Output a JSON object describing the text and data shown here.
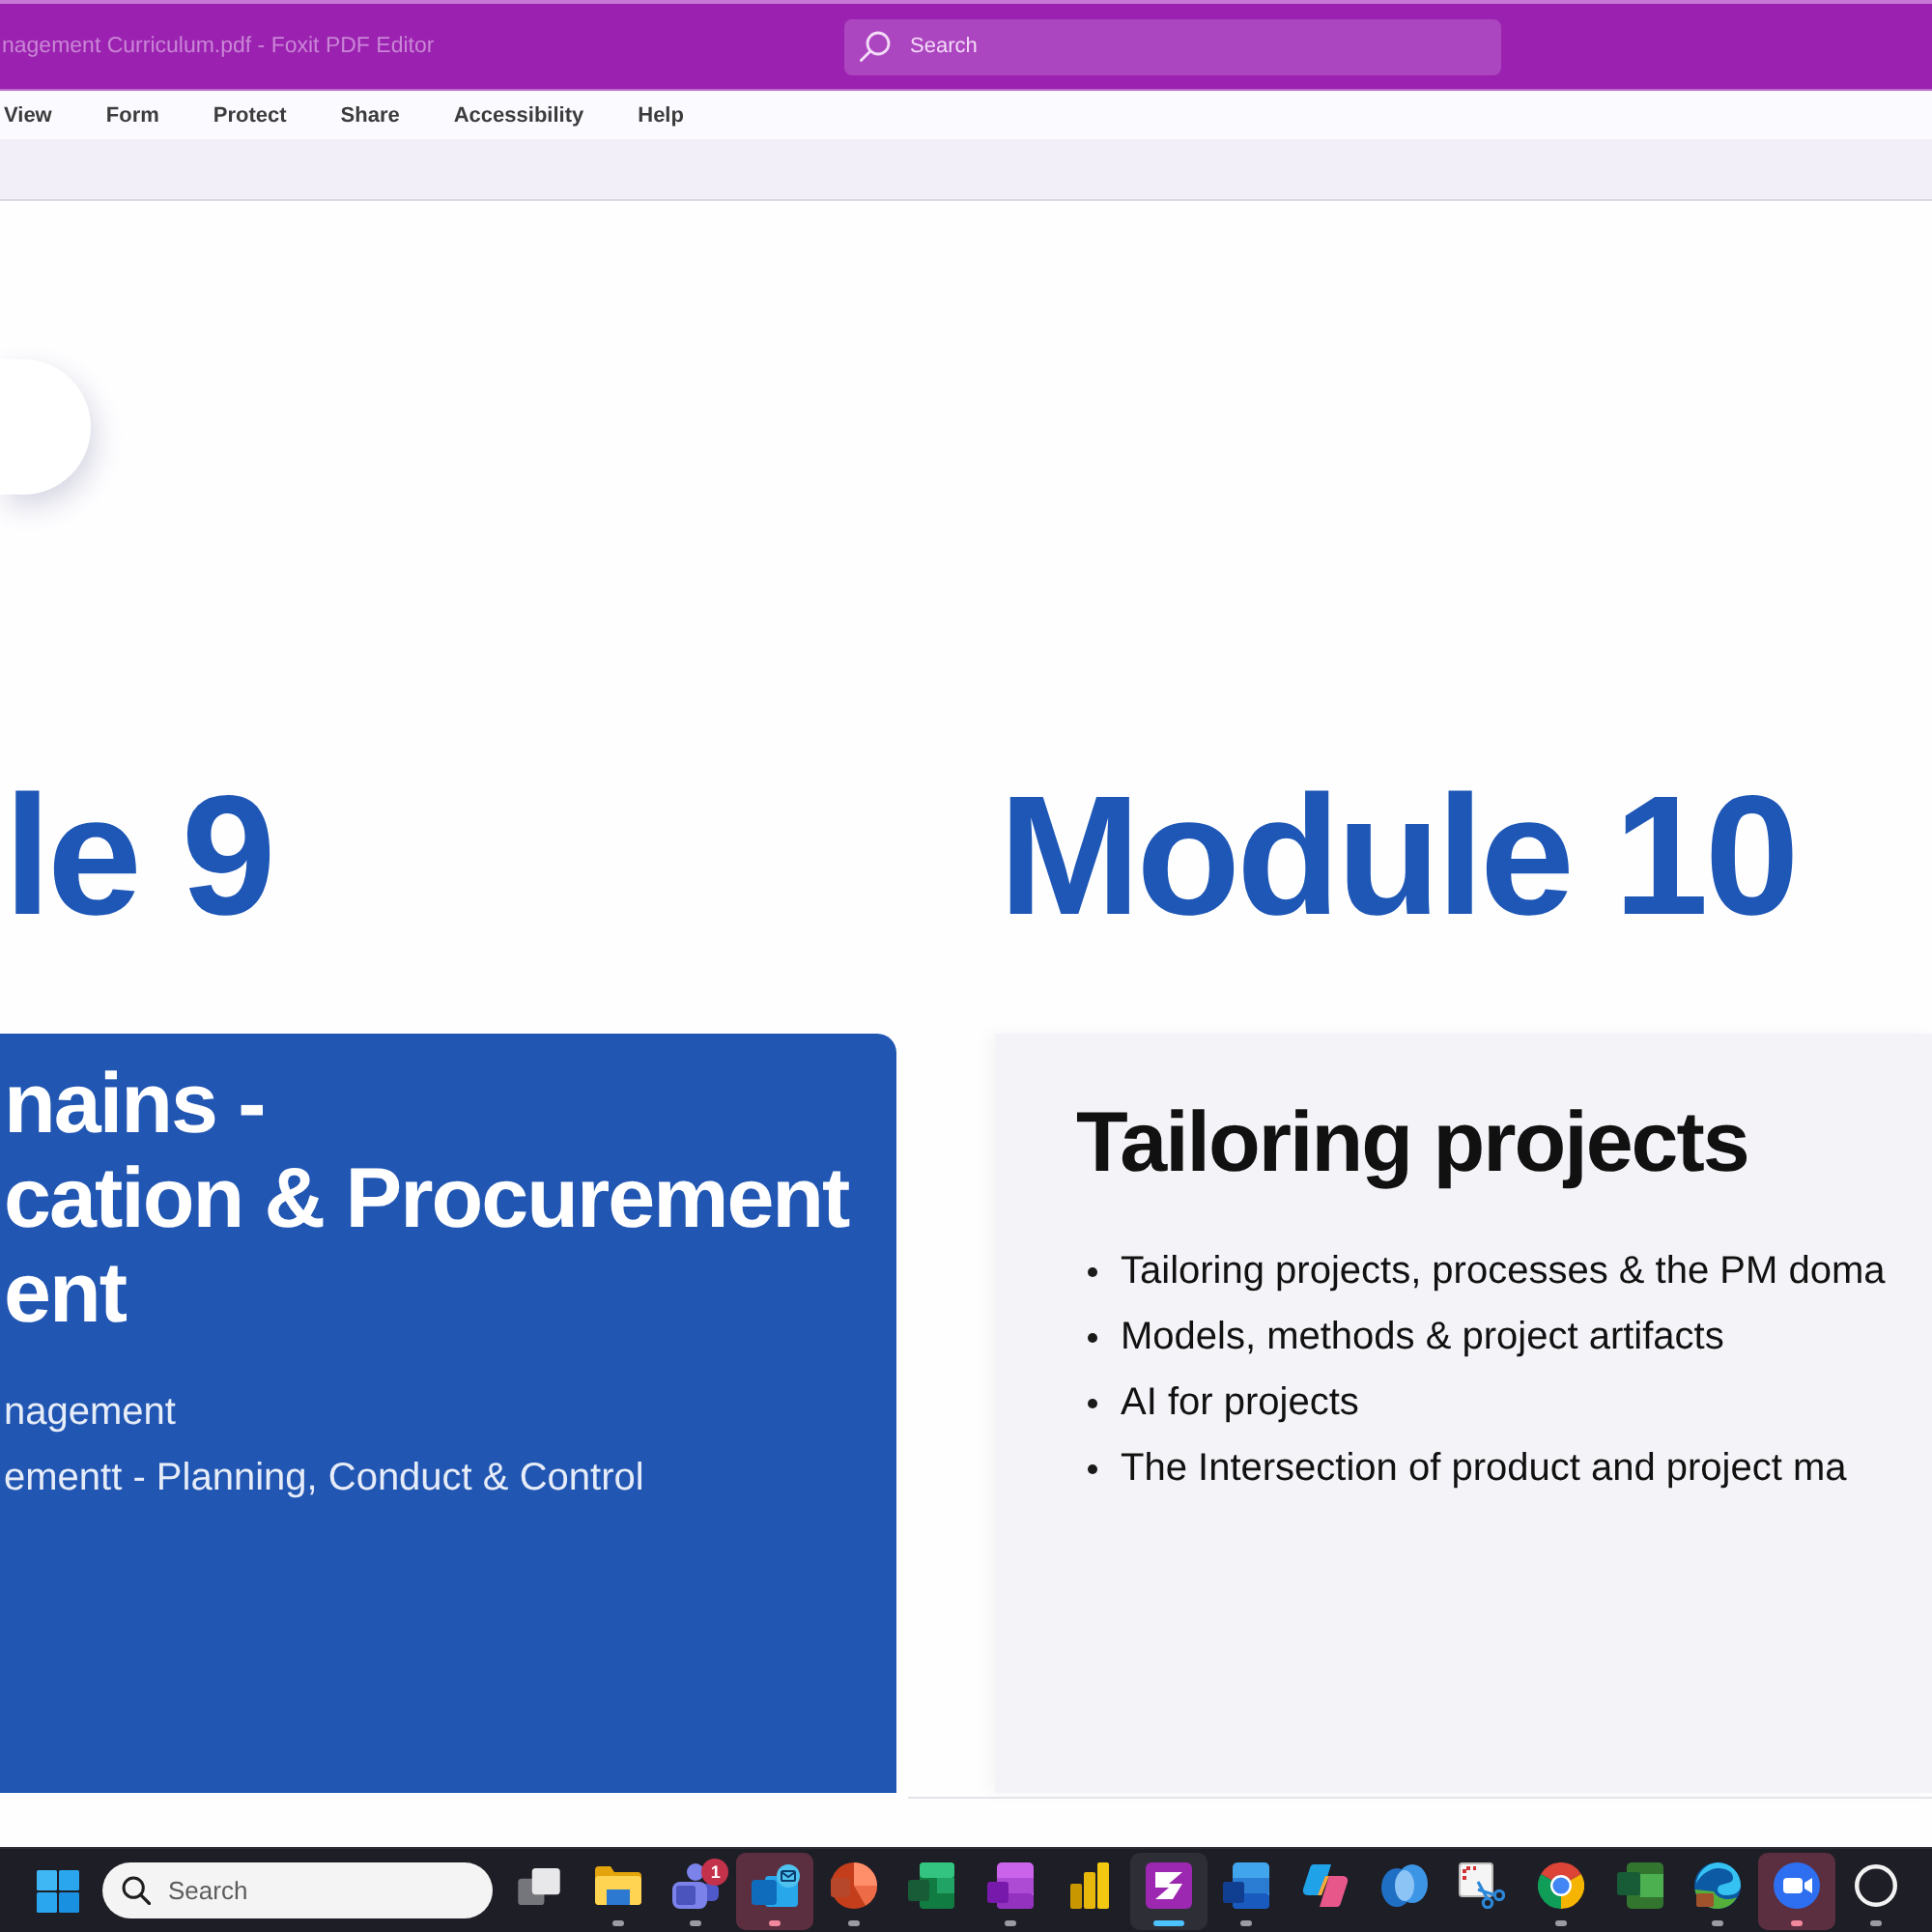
{
  "window": {
    "title": "nagement Curriculum.pdf - Foxit PDF Editor",
    "search": {
      "placeholder": "Search"
    }
  },
  "menu": [
    "View",
    "Form",
    "Protect",
    "Share",
    "Accessibility",
    "Help"
  ],
  "document": {
    "columns": [
      {
        "module_title": "le 9",
        "card": {
          "kind": "filled",
          "heading_lines": [
            "nains -",
            "cation & Procurement",
            "ent"
          ],
          "items": [
            "nagement",
            "ementt - Planning, Conduct & Control"
          ]
        }
      },
      {
        "module_title": "Module 10",
        "card": {
          "kind": "plain",
          "heading_lines": [
            "Tailoring projects"
          ],
          "items": [
            "Tailoring projects, processes & the PM doma",
            "Models, methods & project artifacts",
            "AI for projects",
            "The Intersection of product and project ma"
          ]
        }
      }
    ]
  },
  "taskbar": {
    "search": {
      "placeholder": "Search"
    },
    "apps": [
      {
        "kind": "task-view",
        "running": false,
        "selected": false,
        "attention": false
      },
      {
        "kind": "folder",
        "running": true,
        "selected": false,
        "attention": false
      },
      {
        "kind": "people",
        "running": true,
        "selected": false,
        "attention": false,
        "badge": "1"
      },
      {
        "kind": "mail",
        "running": true,
        "selected": false,
        "attention": true
      },
      {
        "kind": "presentation",
        "running": true,
        "selected": false,
        "attention": false
      },
      {
        "kind": "spreadsheet",
        "running": false,
        "selected": false,
        "attention": false
      },
      {
        "kind": "notebook",
        "running": true,
        "selected": false,
        "attention": false
      },
      {
        "kind": "bar-chart",
        "running": false,
        "selected": false,
        "attention": false
      },
      {
        "kind": "pdf",
        "running": true,
        "selected": true,
        "attention": false
      },
      {
        "kind": "document",
        "running": true,
        "selected": false,
        "attention": false
      },
      {
        "kind": "swirl",
        "running": false,
        "selected": false,
        "attention": false
      },
      {
        "kind": "cloud",
        "running": false,
        "selected": false,
        "attention": false
      },
      {
        "kind": "snip",
        "running": false,
        "selected": false,
        "attention": false
      },
      {
        "kind": "browser",
        "running": true,
        "selected": false,
        "attention": false
      },
      {
        "kind": "project",
        "running": false,
        "selected": false,
        "attention": false
      },
      {
        "kind": "wave",
        "running": true,
        "selected": false,
        "attention": false
      },
      {
        "kind": "video",
        "running": true,
        "selected": false,
        "attention": true
      },
      {
        "kind": "ring",
        "running": true,
        "selected": false,
        "attention": false
      }
    ]
  }
}
